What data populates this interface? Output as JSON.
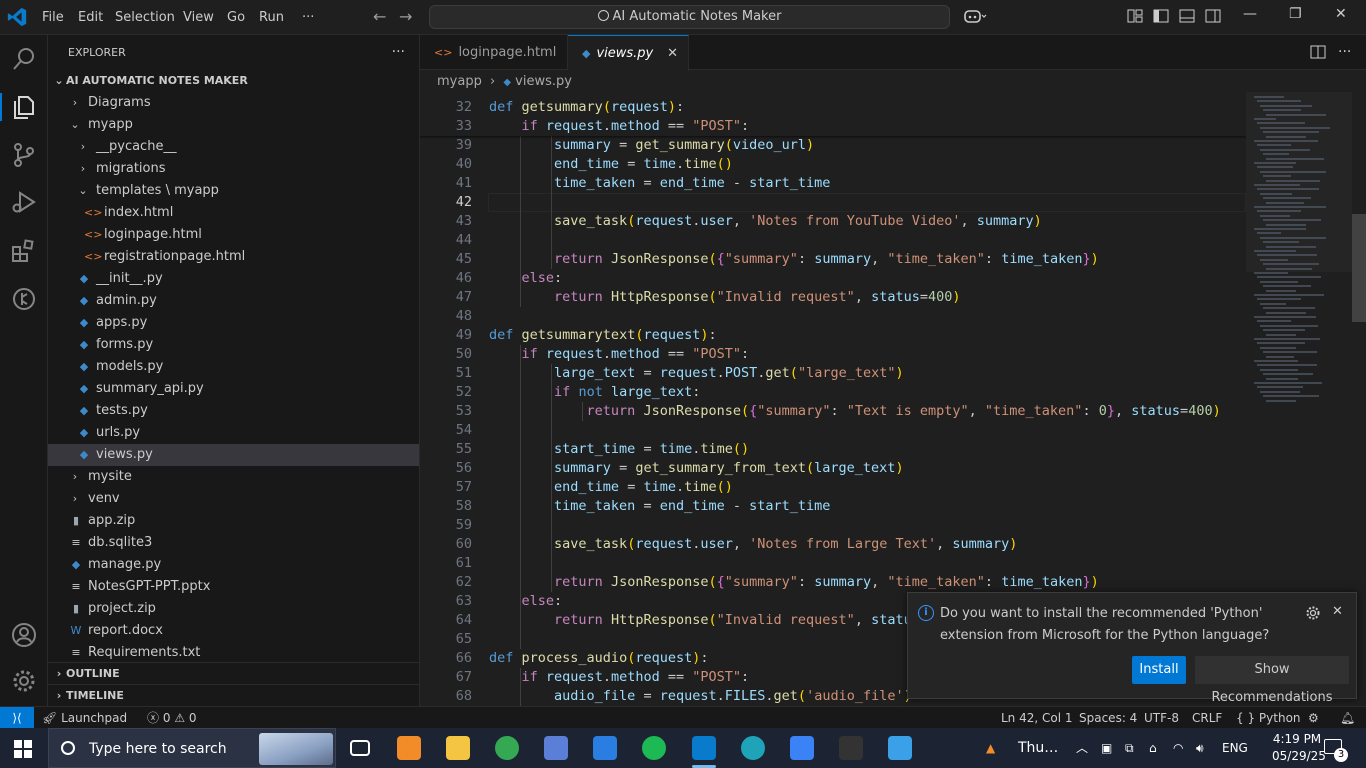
{
  "titlebar": {
    "menu": [
      "File",
      "Edit",
      "Selection",
      "View",
      "Go",
      "Run",
      "···"
    ],
    "command_center": "AI Automatic Notes Maker",
    "icons": [
      "vscode-logo-icon",
      "back-arrow-icon",
      "forward-arrow-icon",
      "copilot-icon",
      "layout-icon",
      "toggle-sidebar-icon",
      "toggle-panel-icon",
      "toggle-secondary-sidebar-icon",
      "minimize-icon",
      "restore-icon",
      "close-icon"
    ],
    "minimize": "—",
    "restore": "❐",
    "close": "✕"
  },
  "activity_bar": [
    "explorer-icon",
    "search-icon",
    "source-control-icon",
    "run-debug-icon",
    "extensions-icon",
    "remote-explorer-icon",
    "accounts-icon",
    "settings-gear-icon"
  ],
  "explorer": {
    "title": "EXPLORER",
    "more": "···",
    "root": "AI AUTOMATIC NOTES MAKER",
    "tree": [
      {
        "label": "Diagrams",
        "type": "folder",
        "expanded": false,
        "depth": 1
      },
      {
        "label": "myapp",
        "type": "folder",
        "expanded": true,
        "depth": 1
      },
      {
        "label": "__pycache__",
        "type": "folder",
        "expanded": false,
        "depth": 2
      },
      {
        "label": "migrations",
        "type": "folder",
        "expanded": false,
        "depth": 2
      },
      {
        "label": "templates \\ myapp",
        "type": "folder",
        "expanded": true,
        "depth": 2
      },
      {
        "label": "index.html",
        "type": "html",
        "depth": 3
      },
      {
        "label": "loginpage.html",
        "type": "html",
        "depth": 3
      },
      {
        "label": "registrationpage.html",
        "type": "html",
        "depth": 3
      },
      {
        "label": "__init__.py",
        "type": "py",
        "depth": 2
      },
      {
        "label": "admin.py",
        "type": "py",
        "depth": 2
      },
      {
        "label": "apps.py",
        "type": "py",
        "depth": 2
      },
      {
        "label": "forms.py",
        "type": "py",
        "depth": 2
      },
      {
        "label": "models.py",
        "type": "py",
        "depth": 2
      },
      {
        "label": "summary_api.py",
        "type": "py",
        "depth": 2
      },
      {
        "label": "tests.py",
        "type": "py",
        "depth": 2
      },
      {
        "label": "urls.py",
        "type": "py",
        "depth": 2
      },
      {
        "label": "views.py",
        "type": "py",
        "depth": 2,
        "selected": true
      },
      {
        "label": "mysite",
        "type": "folder",
        "expanded": false,
        "depth": 1
      },
      {
        "label": "venv",
        "type": "folder",
        "expanded": false,
        "depth": 1
      },
      {
        "label": "app.zip",
        "type": "zip",
        "depth": 1
      },
      {
        "label": "db.sqlite3",
        "type": "db",
        "depth": 1
      },
      {
        "label": "manage.py",
        "type": "py",
        "depth": 1
      },
      {
        "label": "NotesGPT-PPT.pptx",
        "type": "txt",
        "depth": 1
      },
      {
        "label": "project.zip",
        "type": "zip",
        "depth": 1
      },
      {
        "label": "report.docx",
        "type": "docx",
        "depth": 1
      },
      {
        "label": "Requirements.txt",
        "type": "txt",
        "depth": 1
      }
    ],
    "outline": "OUTLINE",
    "timeline": "TIMELINE"
  },
  "tabs": [
    {
      "label": "loginpage.html",
      "active": false
    },
    {
      "label": "views.py",
      "active": true
    }
  ],
  "breadcrumb": [
    "myapp",
    "views.py"
  ],
  "editor": {
    "current_line": "42",
    "lines": [
      {
        "n": "32",
        "sticky": true,
        "html": "<span class='kw'>def</span> <span class='fn'>getsummary</span><span class='br'>(</span><span class='pr'>request</span><span class='br'>)</span>:"
      },
      {
        "n": "33",
        "sticky": true,
        "html": "    <span class='kc'>if</span> <span class='pr'>request</span>.<span class='pr'>method</span> == <span class='str'>\"POST\"</span>:"
      },
      {
        "n": "39",
        "html": "        <span class='pr'>summary</span> = <span class='fn'>get_summary</span><span class='br'>(</span><span class='pr'>video_url</span><span class='br'>)</span>"
      },
      {
        "n": "40",
        "html": "        <span class='pr'>end_time</span> = <span class='pr'>time</span>.<span class='fn'>time</span><span class='br'>()</span>"
      },
      {
        "n": "41",
        "html": "        <span class='pr'>time_taken</span> = <span class='pr'>end_time</span> - <span class='pr'>start_time</span>"
      },
      {
        "n": "42",
        "html": ""
      },
      {
        "n": "43",
        "html": "        <span class='fn'>save_task</span><span class='br'>(</span><span class='pr'>request</span>.<span class='pr'>user</span>, <span class='str'>'Notes from YouTube Video'</span>, <span class='pr'>summary</span><span class='br'>)</span>"
      },
      {
        "n": "44",
        "html": ""
      },
      {
        "n": "45",
        "html": "        <span class='kc'>return</span> <span class='fn'>JsonResponse</span><span class='br'>(</span><span class='br2'>{</span><span class='str'>\"summary\"</span>: <span class='pr'>summary</span>, <span class='str'>\"time_taken\"</span>: <span class='pr'>time_taken</span><span class='br2'>}</span><span class='br'>)</span>"
      },
      {
        "n": "46",
        "html": "    <span class='kc'>else</span>:"
      },
      {
        "n": "47",
        "html": "        <span class='kc'>return</span> <span class='fn'>HttpResponse</span><span class='br'>(</span><span class='str'>\"Invalid request\"</span>, <span class='pr'>status</span>=<span class='num'>400</span><span class='br'>)</span>"
      },
      {
        "n": "48",
        "html": ""
      },
      {
        "n": "49",
        "html": "<span class='kw'>def</span> <span class='fn'>getsummarytext</span><span class='br'>(</span><span class='pr'>request</span><span class='br'>)</span>:"
      },
      {
        "n": "50",
        "html": "    <span class='kc'>if</span> <span class='pr'>request</span>.<span class='pr'>method</span> == <span class='str'>\"POST\"</span>:"
      },
      {
        "n": "51",
        "html": "        <span class='pr'>large_text</span> = <span class='pr'>request</span>.<span class='pr'>POST</span>.<span class='fn'>get</span><span class='br'>(</span><span class='str'>\"large_text\"</span><span class='br'>)</span>"
      },
      {
        "n": "52",
        "html": "        <span class='kc'>if</span> <span class='kw'>not</span> <span class='pr'>large_text</span>:"
      },
      {
        "n": "53",
        "html": "            <span class='kc'>return</span> <span class='fn'>JsonResponse</span><span class='br'>(</span><span class='br2'>{</span><span class='str'>\"summary\"</span>: <span class='str'>\"Text is empty\"</span>, <span class='str'>\"time_taken\"</span>: <span class='num'>0</span><span class='br2'>}</span>, <span class='pr'>status</span>=<span class='num'>400</span><span class='br'>)</span>"
      },
      {
        "n": "54",
        "html": ""
      },
      {
        "n": "55",
        "html": "        <span class='pr'>start_time</span> = <span class='pr'>time</span>.<span class='fn'>time</span><span class='br'>()</span>"
      },
      {
        "n": "56",
        "html": "        <span class='pr'>summary</span> = <span class='fn'>get_summary_from_text</span><span class='br'>(</span><span class='pr'>large_text</span><span class='br'>)</span>"
      },
      {
        "n": "57",
        "html": "        <span class='pr'>end_time</span> = <span class='pr'>time</span>.<span class='fn'>time</span><span class='br'>()</span>"
      },
      {
        "n": "58",
        "html": "        <span class='pr'>time_taken</span> = <span class='pr'>end_time</span> - <span class='pr'>start_time</span>"
      },
      {
        "n": "59",
        "html": ""
      },
      {
        "n": "60",
        "html": "        <span class='fn'>save_task</span><span class='br'>(</span><span class='pr'>request</span>.<span class='pr'>user</span>, <span class='str'>'Notes from Large Text'</span>, <span class='pr'>summary</span><span class='br'>)</span>"
      },
      {
        "n": "61",
        "html": ""
      },
      {
        "n": "62",
        "html": "        <span class='kc'>return</span> <span class='fn'>JsonResponse</span><span class='br'>(</span><span class='br2'>{</span><span class='str'>\"summary\"</span>: <span class='pr'>summary</span>, <span class='str'>\"time_taken\"</span>: <span class='pr'>time_taken</span><span class='br2'>}</span><span class='br'>)</span>"
      },
      {
        "n": "63",
        "html": "    <span class='kc'>else</span>:"
      },
      {
        "n": "64",
        "html": "        <span class='kc'>return</span> <span class='fn'>HttpResponse</span><span class='br'>(</span><span class='str'>\"Invalid request\"</span>, <span class='pr'>status</span>=<span class='num'>400</span><span class='br'>)</span>"
      },
      {
        "n": "65",
        "html": ""
      },
      {
        "n": "66",
        "html": "<span class='kw'>def</span> <span class='fn'>process_audio</span><span class='br'>(</span><span class='pr'>request</span><span class='br'>)</span>:"
      },
      {
        "n": "67",
        "html": "    <span class='kc'>if</span> <span class='pr'>request</span>.<span class='pr'>method</span> == <span class='str'>\"POST\"</span>:"
      },
      {
        "n": "68",
        "html": "        <span class='pr'>audio_file</span> = <span class='pr'>request</span>.<span class='pr'>FILES</span>.<span class='fn'>get</span><span class='br'>(</span><span class='str'>'audio_file'</span><span class='br'>)</span>"
      }
    ]
  },
  "notification": {
    "message": "Do you want to install the recommended 'Python' extension from Microsoft for the Python language?",
    "info_glyph": "i",
    "install": "Install",
    "show_recommendations": "Show Recommendations",
    "close": "✕"
  },
  "statusbar": {
    "remote": "⟩⟨",
    "launchpad": "Launchpad",
    "errors": "0",
    "warnings": "0",
    "position": "Ln 42, Col 1",
    "spaces": "Spaces: 4",
    "encoding": "UTF-8",
    "eol": "CRLF",
    "language": "Python",
    "language_glyph": "{ }"
  },
  "taskbar": {
    "search_placeholder": "Type here to search",
    "apps": [
      {
        "name": "task-view",
        "color": "#2b3244",
        "active": false
      },
      {
        "name": "sublime-text",
        "color": "#f28c28",
        "active": false
      },
      {
        "name": "file-explorer",
        "color": "#f4c542",
        "active": false
      },
      {
        "name": "chrome",
        "color": "#34a853",
        "active": false
      },
      {
        "name": "remote-desktop",
        "color": "#5b7fd6",
        "active": false
      },
      {
        "name": "microsoft-store",
        "color": "#2a7de1",
        "active": false
      },
      {
        "name": "spotify",
        "color": "#1db954",
        "active": false
      },
      {
        "name": "vscode",
        "color": "#0a7acc",
        "active": true
      },
      {
        "name": "edge",
        "color": "#1fa3b8",
        "active": false
      },
      {
        "name": "app-blue",
        "color": "#3b82f6",
        "active": false
      },
      {
        "name": "terminal",
        "color": "#333333",
        "active": false
      },
      {
        "name": "photos",
        "color": "#3aa0e8",
        "active": false
      }
    ],
    "weather": "Thu…",
    "language": "ENG",
    "time": "4:19 PM",
    "date": "05/29/25",
    "notifications": "3"
  }
}
